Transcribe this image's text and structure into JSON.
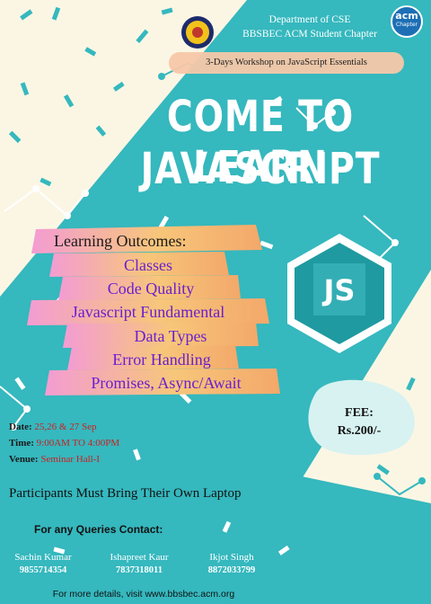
{
  "header": {
    "department": "Department of CSE",
    "chapter": "BBSBEC ACM Student Chapter",
    "acm_badge_top": "acm",
    "acm_badge_bottom": "Chapter",
    "college_logo": "college-emblem"
  },
  "workshop": "3-Days Workshop on JavaScript Essentials",
  "headline": {
    "line1": "COME TO LEARN",
    "line2": "JAVASCRIPT"
  },
  "outcomes": {
    "title": "Learning Outcomes:",
    "items": [
      "Classes",
      "Code Quality",
      "Javascript Fundamental",
      "Data Types",
      "Error Handling",
      "Promises, Async/Await"
    ]
  },
  "js_badge": "JS",
  "event": {
    "date_label": "Date:",
    "date_value": "25,26 & 27 Sep",
    "time_label": "Time:",
    "time_value": "9:00AM TO 4:00PM",
    "venue_label": "Venue:",
    "venue_value": "Seminar Hall-I"
  },
  "fee": {
    "label": "FEE:",
    "value": "Rs.200/-"
  },
  "notice": "Participants Must Bring Their Own Laptop",
  "contacts": {
    "title": "For any Queries Contact:",
    "people": [
      {
        "name": "Sachin Kumar",
        "phone": "9855714354"
      },
      {
        "name": "Ishapreet Kaur",
        "phone": "7837318011"
      },
      {
        "name": "Ikjot Singh",
        "phone": "8872033799"
      }
    ]
  },
  "footer": "For more details, visit www.bbsbec.acm.org",
  "colors": {
    "teal": "#35b8be",
    "cream": "#fbf6e4",
    "outcome_purple": "#6a1fd0",
    "detail_red": "#cc1f1f",
    "js_hex": "#1f9aa0"
  }
}
